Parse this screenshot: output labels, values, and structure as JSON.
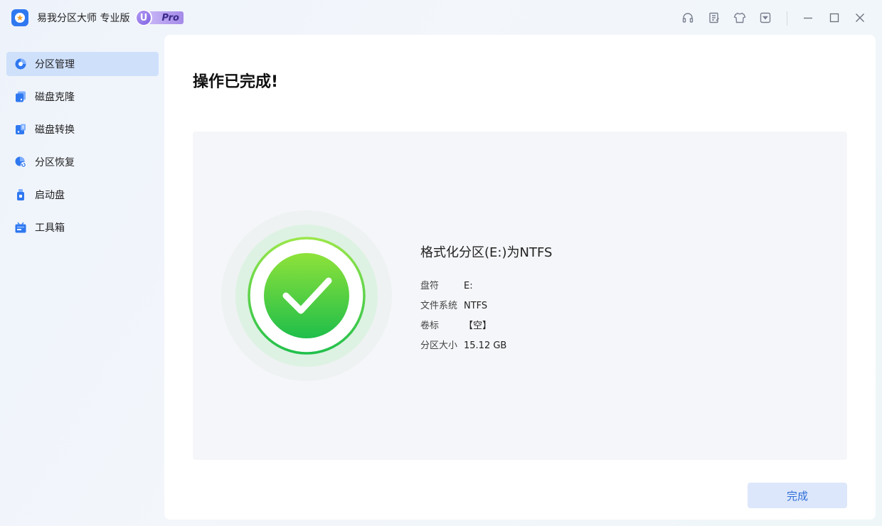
{
  "app": {
    "title": "易我分区大师 专业版",
    "badge_u": "U",
    "badge_pro": "Pro"
  },
  "toolbar": {
    "icons": [
      "headset-icon",
      "feedback-icon",
      "theme-shirt-icon",
      "dropdown-menu-icon",
      "minimize-icon",
      "maximize-icon",
      "close-icon"
    ]
  },
  "sidebar": {
    "items": [
      {
        "label": "分区管理",
        "icon": "partition-pie-icon",
        "active": true
      },
      {
        "label": "磁盘克隆",
        "icon": "disk-clone-icon",
        "active": false
      },
      {
        "label": "磁盘转换",
        "icon": "disk-convert-icon",
        "active": false
      },
      {
        "label": "分区恢复",
        "icon": "partition-recovery-icon",
        "active": false
      },
      {
        "label": "启动盘",
        "icon": "boot-usb-icon",
        "active": false
      },
      {
        "label": "工具箱",
        "icon": "toolbox-icon",
        "active": false
      }
    ]
  },
  "main": {
    "title": "操作已完成!",
    "operation": "格式化分区(E:)为NTFS",
    "details": [
      {
        "key": "盘符",
        "value": "E:"
      },
      {
        "key": "文件系统",
        "value": "NTFS"
      },
      {
        "key": "卷标",
        "value": "【空】"
      },
      {
        "key": "分区大小",
        "value": "15.12 GB"
      }
    ],
    "done_label": "完成"
  },
  "colors": {
    "accent": "#2f6fd8",
    "active_nav_bg": "#cfe0fb",
    "success_green": "#3ec43f"
  }
}
